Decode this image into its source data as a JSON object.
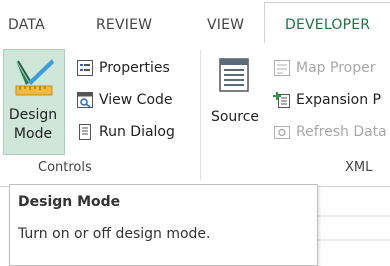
{
  "tabs": [
    "DATA",
    "REVIEW",
    "VIEW",
    "DEVELOPER"
  ],
  "controls": {
    "design_mode_line1": "Design",
    "design_mode_line2": "Mode",
    "properties": "Properties",
    "view_code": "View Code",
    "run_dialog": "Run Dialog",
    "group_label": "Controls"
  },
  "xml": {
    "source": "Source",
    "map_properties": "Map Proper",
    "expansion_packs": "Expansion P",
    "refresh_data": "Refresh Data",
    "group_label": "XML"
  },
  "tooltip": {
    "title": "Design Mode",
    "description": "Turn on or off design mode."
  },
  "colors": {
    "accent": "#217346",
    "selected_bg": "#cfe6d9",
    "disabled_text": "#a8a8a8"
  }
}
